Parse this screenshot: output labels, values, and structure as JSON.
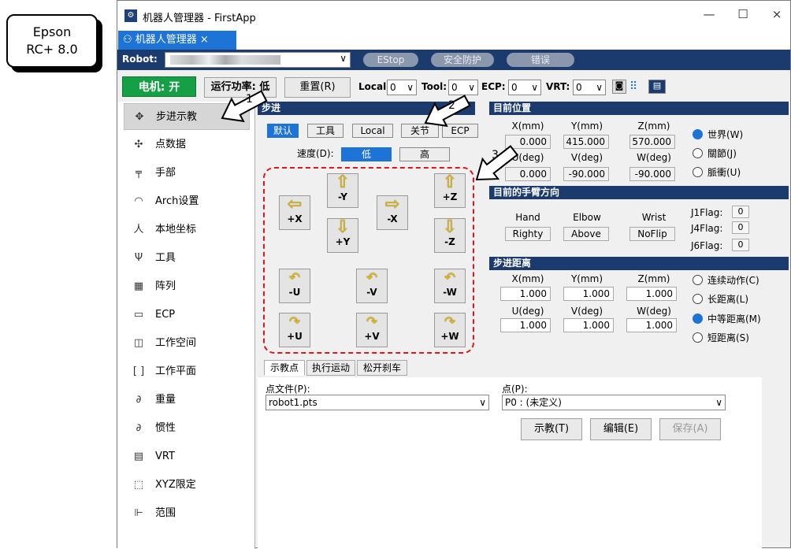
{
  "callout": {
    "line1": "Epson",
    "line2": "RC+ 8.0"
  },
  "window": {
    "title": "机器人管理器 - FirstApp",
    "tab": "机器人管理器 ×",
    "min": "—",
    "max": "☐",
    "close": "×"
  },
  "robotbar": {
    "label": "Robot:",
    "estop": "EStop",
    "safety": "安全防护",
    "error": "错误"
  },
  "cmdbar": {
    "motor": "电机: 开",
    "power": "运行功率: 低",
    "reset": "重置(R)",
    "local_label": "Local:",
    "local_val": "0",
    "tool_label": "Tool:",
    "tool_val": "0",
    "ecp_label": "ECP:",
    "ecp_val": "0",
    "vrt_label": "VRT:",
    "vrt_val": "0"
  },
  "sidebar": {
    "items": [
      {
        "icon": "✥",
        "label": "步进示教"
      },
      {
        "icon": "✣",
        "label": "点数据"
      },
      {
        "icon": "╤",
        "label": "手部"
      },
      {
        "icon": "◠",
        "label": "Arch设置"
      },
      {
        "icon": "人",
        "label": "本地坐标"
      },
      {
        "icon": "Ψ",
        "label": "工具"
      },
      {
        "icon": "▦",
        "label": "阵列"
      },
      {
        "icon": "▭",
        "label": "ECP"
      },
      {
        "icon": "◫",
        "label": "工作空间"
      },
      {
        "icon": "[ ]",
        "label": "工作平面"
      },
      {
        "icon": "∂",
        "label": "重量"
      },
      {
        "icon": "∂",
        "label": "惯性"
      },
      {
        "icon": "▤",
        "label": "VRT"
      },
      {
        "icon": "⬚",
        "label": "XYZ限定"
      },
      {
        "icon": "⊩",
        "label": "范围"
      }
    ]
  },
  "jog": {
    "header": "步进",
    "modes": [
      "默认",
      "工具",
      "Local",
      "关节",
      "ECP"
    ],
    "speed_label": "速度(D):",
    "speed_low": "低",
    "speed_high": "高",
    "buttons": {
      "py": "-Y",
      "mx_left": "+X",
      "mx": "-X",
      "ny": "+Y",
      "pz": "+Z",
      "nz": "-Z",
      "mu": "-U",
      "mv": "-V",
      "mw": "-W",
      "pu": "+U",
      "pv": "+V",
      "pw": "+W"
    }
  },
  "position": {
    "header": "目前位置",
    "cols": [
      "X(mm)",
      "Y(mm)",
      "Z(mm)"
    ],
    "row1": [
      "0.000",
      "415.000",
      "570.000"
    ],
    "cols2": [
      "U(deg)",
      "V(deg)",
      "W(deg)"
    ],
    "row2": [
      "0.000",
      "-90.000",
      "-90.000"
    ],
    "radios": [
      "世界(W)",
      "關節(J)",
      "脈衝(U)"
    ]
  },
  "orientation": {
    "header": "目前的手臂方向",
    "cols": [
      "Hand",
      "Elbow",
      "Wrist"
    ],
    "vals": [
      "Righty",
      "Above",
      "NoFlip"
    ],
    "flags": [
      {
        "label": "J1Flag:",
        "val": "0"
      },
      {
        "label": "J4Flag:",
        "val": "0"
      },
      {
        "label": "J6Flag:",
        "val": "0"
      }
    ]
  },
  "distance": {
    "header": "步进距离",
    "cols": [
      "X(mm)",
      "Y(mm)",
      "Z(mm)"
    ],
    "row1": [
      "1.000",
      "1.000",
      "1.000"
    ],
    "cols2": [
      "U(deg)",
      "V(deg)",
      "W(deg)"
    ],
    "row2": [
      "1.000",
      "1.000",
      "1.000"
    ],
    "radios": [
      "连续动作(C)",
      "长距离(L)",
      "中等距离(M)",
      "短距离(S)"
    ]
  },
  "bottom": {
    "tabs": [
      "示教点",
      "执行运动",
      "松开刹车"
    ],
    "file_label": "点文件(P):",
    "file_val": "robot1.pts",
    "point_label": "点(P):",
    "point_val": "P0 : (未定义)",
    "teach": "示教(T)",
    "edit": "编辑(E)",
    "save": "保存(A)"
  },
  "annotations": [
    "1",
    "2",
    "3"
  ]
}
